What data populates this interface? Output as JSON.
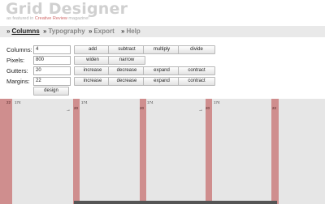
{
  "header": {
    "title": "Grid Designer",
    "subtitle_prefix": "as featured in ",
    "subtitle_brand": "Creative Review",
    "subtitle_suffix": " magazine!"
  },
  "nav": {
    "items": [
      {
        "label": "Columns",
        "active": true
      },
      {
        "label": "Typography",
        "active": false
      },
      {
        "label": "Export",
        "active": false
      },
      {
        "label": "Help",
        "active": false
      }
    ],
    "arrow": "»"
  },
  "form": {
    "columns": {
      "label": "Columns:",
      "value": "4",
      "buttons": [
        "add",
        "subtract",
        "multiply",
        "divide"
      ]
    },
    "pixels": {
      "label": "Pixels:",
      "value": "800",
      "buttons": [
        "widen",
        "narrow"
      ]
    },
    "gutters": {
      "label": "Gutters:",
      "value": "20",
      "buttons": [
        "increase",
        "decrease",
        "expand",
        "contract"
      ]
    },
    "margins": {
      "label": "Margins:",
      "value": "22",
      "buttons": [
        "increase",
        "decrease",
        "expand",
        "contract"
      ]
    },
    "design_button": "design"
  },
  "grid": {
    "margin_label": "22",
    "gutter_label": "20",
    "column_label": "174",
    "arrow_glyph": "→",
    "colors": {
      "gutter": "#cf8e8e",
      "column": "#e6e6e6"
    }
  }
}
